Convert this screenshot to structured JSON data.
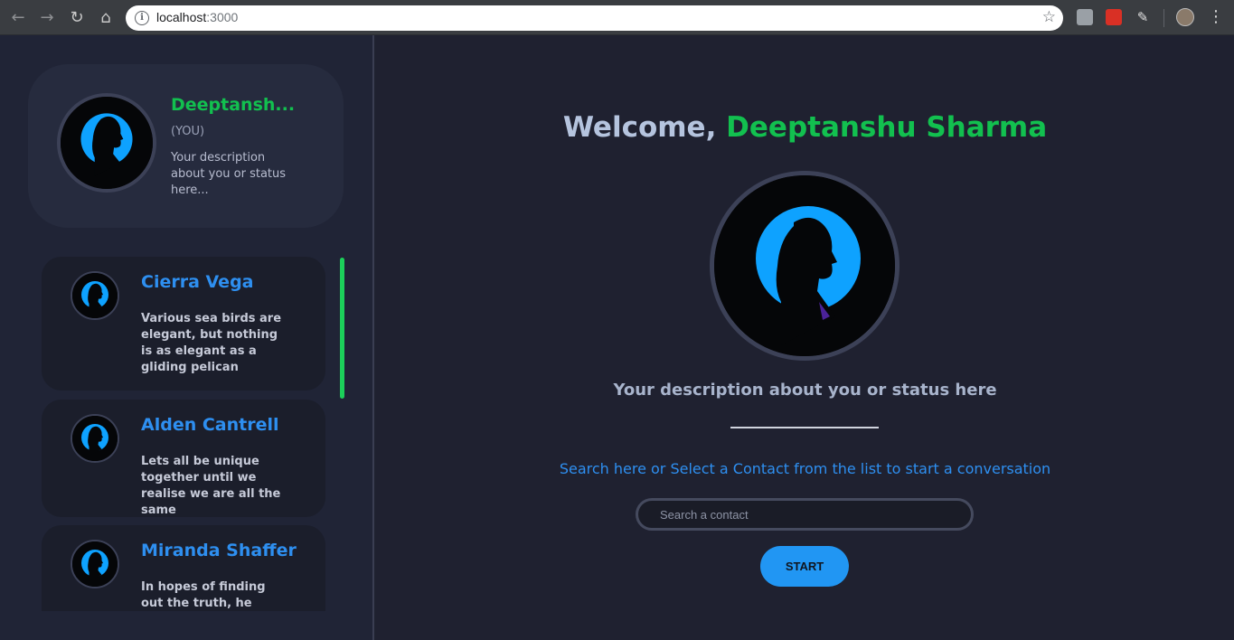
{
  "browser": {
    "url_host": "localhost",
    "url_port": ":3000",
    "back_icon": "arrow-left-icon",
    "forward_icon": "arrow-right-icon",
    "reload_icon": "reload-icon",
    "home_icon": "home-icon",
    "bookmark_icon": "star-icon"
  },
  "sidebar": {
    "me": {
      "name": "Deeptansh...",
      "tag": "(YOU)",
      "description": "Your description about you or status here..."
    },
    "contacts": [
      {
        "name": "Cierra Vega",
        "message": "Various sea birds are elegant, but nothing is as elegant as a gliding pelican"
      },
      {
        "name": "Alden Cantrell",
        "message": "Lets all be unique together until we realise we are all the same"
      },
      {
        "name": "Miranda Shaffer",
        "message": "In hopes of finding out the truth, he entered the"
      }
    ]
  },
  "main": {
    "welcome_prefix": "Welcome, ",
    "welcome_name": "Deeptanshu Sharma",
    "status": "Your description about you or status here",
    "hint": "Search here or Select a Contact from the list to start a conversation",
    "search_placeholder": "Search a contact",
    "start_label": "START"
  },
  "colors": {
    "accent_green": "#12c04f",
    "accent_blue": "#2e8ff0",
    "background": "#1f2130",
    "sidebar": "#202436"
  }
}
